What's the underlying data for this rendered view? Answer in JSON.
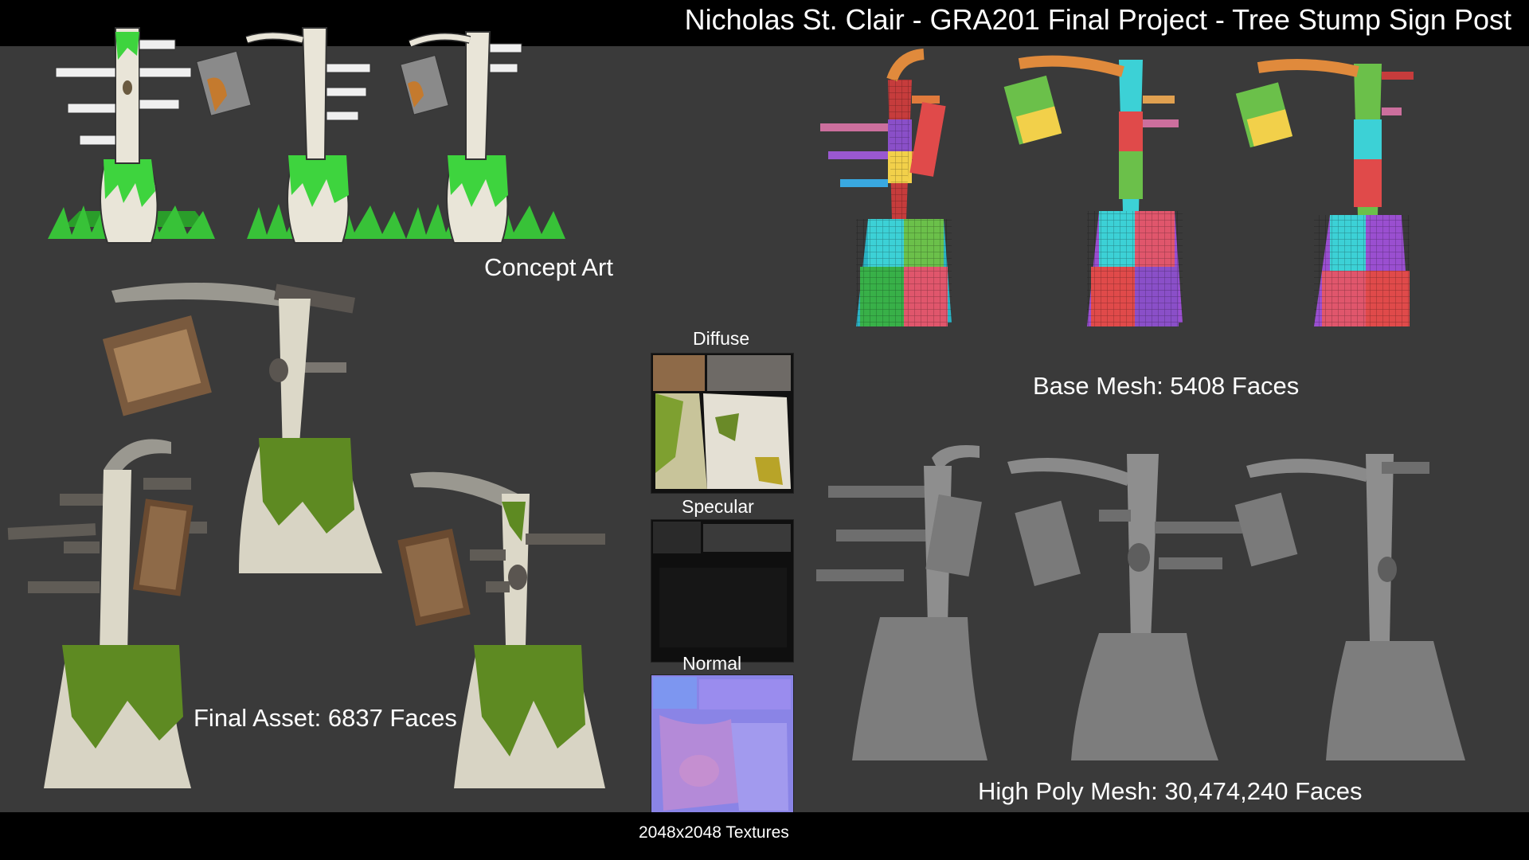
{
  "header": {
    "title": "Nicholas St. Clair - GRA201 Final Project - Tree Stump Sign Post"
  },
  "sections": {
    "concept_art": "Concept Art",
    "base_mesh": "Base Mesh: 5408 Faces",
    "final_asset": "Final Asset: 6837 Faces",
    "high_poly": "High Poly Mesh: 30,474,240 Faces"
  },
  "textures": {
    "diffuse": "Diffuse",
    "specular": "Specular",
    "normal": "Normal",
    "resolution": "2048x2048 Textures"
  },
  "colors": {
    "background": "#3a3a3a",
    "bars": "#000000",
    "moss": "#5e8a22",
    "bark": "#e8e3d6",
    "concept_green": "#3bd43b",
    "clay": "#7d7d7d",
    "normal_map": "#8a84e6"
  }
}
